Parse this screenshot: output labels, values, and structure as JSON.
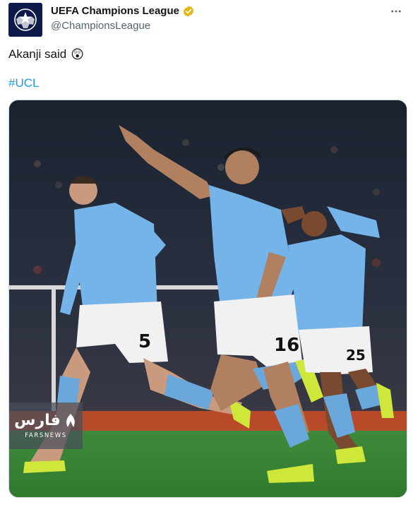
{
  "account": {
    "name": "UEFA Champions League",
    "handle": "@ChampionsLeague",
    "verified_color": "#e2b719",
    "avatar_bg": "#0d1a4a"
  },
  "post": {
    "text": "Akanji said",
    "emoji": "😲",
    "hashtag": "#UCL",
    "hashtag_color": "#1d9bf0"
  },
  "media": {
    "alt": "Manchester City players celebrating a goal",
    "players": [
      {
        "number": "5",
        "label": "player-number-5"
      },
      {
        "number": "16",
        "label": "player-number-16"
      },
      {
        "number": "25",
        "label": "player-number-25"
      }
    ],
    "watermark": {
      "logo_text": "فارس",
      "sub_text": "FARSNEWS"
    }
  },
  "icons": {
    "avatar": "starball-logo-icon",
    "verified": "verified-badge-icon",
    "more": "more-options-icon"
  }
}
